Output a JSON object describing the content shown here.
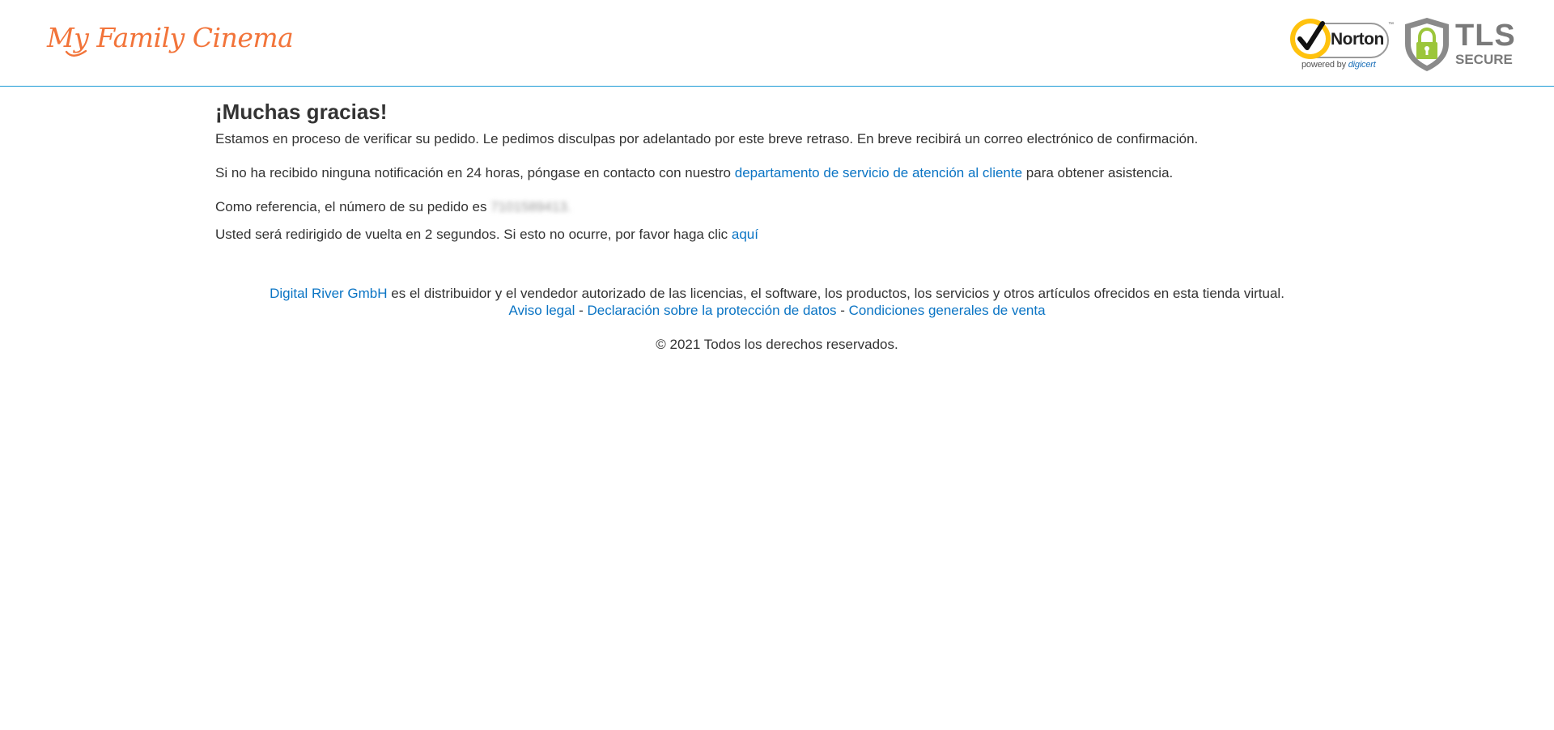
{
  "header": {
    "logo_text": "My Family Cinema",
    "norton": {
      "word": "Norton",
      "tm": "™",
      "powered_by": "powered by",
      "powered_brand": "digicert"
    },
    "tls": {
      "line1": "TLS",
      "line2": "SECURE"
    }
  },
  "main": {
    "title": "¡Muchas gracias!",
    "paragraph1": "Estamos en proceso de verificar su pedido. Le pedimos disculpas por adelantado por este breve retraso. En breve recibirá un correo electrónico de confirmación.",
    "paragraph2_before": "Si no ha recibido ninguna notificación en 24 horas, póngase en contacto con nuestro ",
    "paragraph2_link": "departamento de servicio de atención al cliente",
    "paragraph2_after": " para obtener asistencia.",
    "paragraph3_before": "Como referencia, el número de su pedido es ",
    "order_number": "7101589413.",
    "paragraph4_before": "Usted será redirigido de vuelta en 2 segundos. Si esto no ocurre, por favor haga clic ",
    "paragraph4_link": "aquí"
  },
  "footer": {
    "distributor_link": "Digital River GmbH",
    "distributor_text": " es el distribuidor y el vendedor autorizado de las licencias, el software, los productos, los servicios y otros artículos ofrecidos en esta tienda virtual.",
    "legal_link": "Aviso legal",
    "separator": " - ",
    "privacy_link": "Declaración sobre la protección de datos",
    "terms_link": "Condiciones generales de venta",
    "copyright": "© 2021 Todos los derechos reservados."
  },
  "colors": {
    "brand_orange": "#f2743a",
    "link_blue": "#0a74c4",
    "header_rule": "#1a9ad6",
    "norton_yellow": "#ffc20e",
    "tls_gray": "#7a7a7a",
    "tls_green": "#9cc63b"
  }
}
